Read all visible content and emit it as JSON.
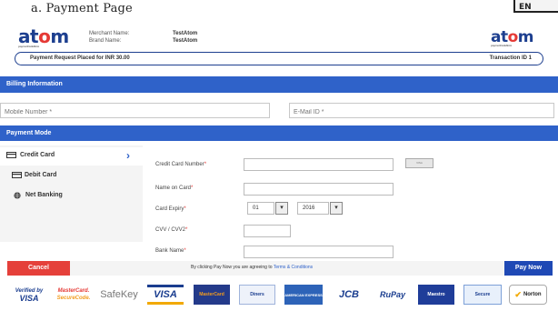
{
  "caption": "a. Payment Page",
  "corner_text": "EN",
  "header": {
    "logo_left": {
      "pre": "at",
      "o": "o",
      "post": "m",
      "tagline": "payment solutions"
    },
    "merchant_label": "Merchant Name:",
    "merchant_value": "TestAtom",
    "brand_label": "Brand Name:",
    "brand_value": "TestAtom",
    "logo_right": {
      "pre": "at",
      "o": "o",
      "post": "m",
      "tagline": "payment solutions"
    }
  },
  "request_bar": {
    "text": "Payment Request Placed for INR 30.00",
    "transaction": "Transaction ID 1"
  },
  "billing": {
    "title": "Billing Information",
    "mobile_placeholder": "Mobile Number *",
    "email_placeholder": "E-Mail ID *"
  },
  "payment_mode": {
    "title": "Payment Mode",
    "items": [
      {
        "label": "Credit Card",
        "icon": "credit-card-icon",
        "active": true
      },
      {
        "label": "Debit Card",
        "icon": "debit-card-icon",
        "active": false
      },
      {
        "label": "Net Banking",
        "icon": "globe-icon",
        "active": false
      }
    ]
  },
  "form": {
    "card_number_label": "Credit Card Number",
    "name_label": "Name on Card",
    "expiry_label": "Card Expiry",
    "expiry_month": "01",
    "expiry_year": "2016",
    "cvv_label": "CVV / CVV2",
    "bank_label": "Bank Name",
    "required_mark": "*",
    "card_icon_text": "VISA"
  },
  "footer": {
    "cancel": "Cancel",
    "terms_prefix": "By clicking Pay Now you are agreeing to",
    "terms_link": "Terms & Conditions",
    "pay": "Pay Now"
  },
  "brands": {
    "verified_visa_line1": "Verified by",
    "verified_visa_line2": "VISA",
    "mastercard_line1": "MasterCard.",
    "mastercard_line2": "SecureCode.",
    "safekey": "SafeKey",
    "visa": "VISA",
    "mastercard": "MasterCard",
    "diners": "Diners",
    "amex": "AMERICAN EXPRESS",
    "jcb": "JCB",
    "rupay": "RuPay",
    "maestro": "Maestro",
    "secure": "Secure",
    "norton": "Norton"
  },
  "colors": {
    "primary_blue": "#2f62c9",
    "cancel_red": "#e5403a",
    "pay_blue": "#1f49b5",
    "logo_blue": "#1d3f8f",
    "logo_red": "#e53935"
  }
}
